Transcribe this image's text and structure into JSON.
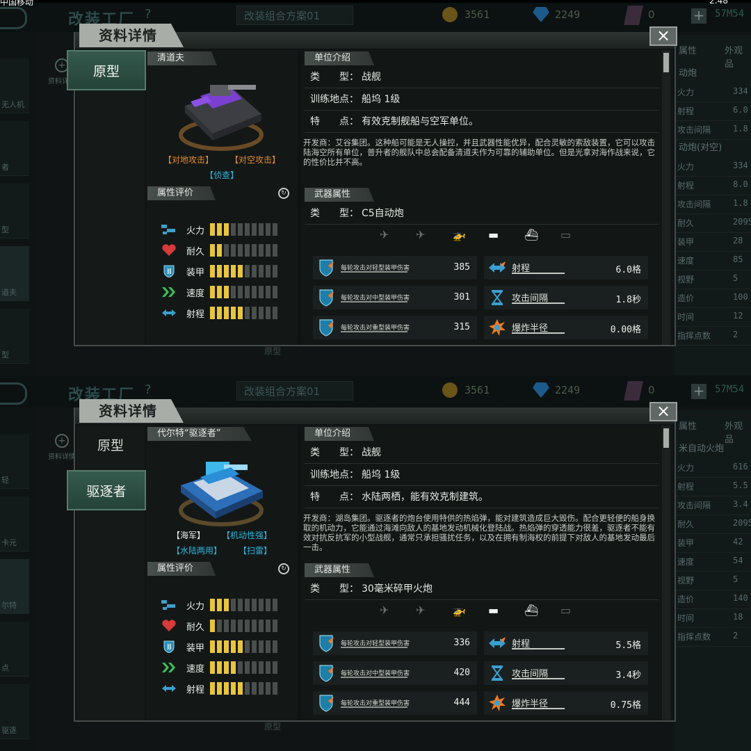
{
  "status_bar": {
    "carrier": "中国移动",
    "time": "2:48"
  },
  "bg": {
    "title": "改装工厂",
    "help": "?",
    "plan": "改装组合方案01",
    "coins": "3561",
    "gems": "2249",
    "tokens": "0",
    "code": "57M54",
    "filter_top": "升者",
    "filter_bot": "型",
    "zoom_label": "资料详情",
    "bottom_label": "原型"
  },
  "top": {
    "dialog_title": "资料详情",
    "close_label": "×",
    "tabs": [
      "原型"
    ],
    "unit_name": "清道夫",
    "tags_line1": [
      "【对地攻击】",
      "【对空攻击】"
    ],
    "tags_line2": [
      "【侦查】"
    ],
    "attr_header": "属性评价",
    "attrs": [
      {
        "label": "火力",
        "value": 3
      },
      {
        "label": "耐久",
        "value": 2
      },
      {
        "label": "装甲",
        "value": 5
      },
      {
        "label": "速度",
        "value": 3
      },
      {
        "label": "射程",
        "value": 5
      }
    ],
    "intro_header": "单位介绍",
    "type_key": "类　　型：",
    "type_val": "战舰",
    "train_key": "训练地点：",
    "train_val": "船坞 1级",
    "feat_key": "特　　点：",
    "feat_val": "有效克制舰船与空军单位。",
    "desc": "开发商：艾谷集团。这种船可能是无人操控，并且武器性能优异，配合灵敏的索敌装置，它可以攻击陆海空所有单位，普升者的舰队中总会配备清道夫作为可靠的辅助单位。但是光拿对海作战来说，它的性价比并不高。",
    "weapon_header": "武器属性",
    "weapon_type_key": "类　　型：",
    "weapon_type_val": "C5自动炮",
    "targets_on": [
      false,
      false,
      true,
      true,
      true,
      false
    ],
    "dmg": [
      {
        "label": "每轮攻击对轻型装甲伤害",
        "value": "385"
      },
      {
        "label": "每轮攻击对中型装甲伤害",
        "value": "301"
      },
      {
        "label": "每轮攻击对重型装甲伤害",
        "value": "315"
      }
    ],
    "stats": [
      {
        "label": "射程",
        "value": "6.0格"
      },
      {
        "label": "攻击间隔",
        "value": "1.8秒"
      },
      {
        "label": "爆炸半径",
        "value": "0.00格"
      }
    ],
    "right_tabs": [
      "属性",
      "外观品"
    ],
    "right_rows": [
      {
        "h": "动炮"
      },
      {
        "k": "火力",
        "v": "334"
      },
      {
        "k": "射程",
        "v": "6.0"
      },
      {
        "k": "攻击间隔",
        "v": "1.8"
      },
      {
        "h": "动炮(对空)"
      },
      {
        "k": "火力",
        "v": "334"
      },
      {
        "k": "射程",
        "v": "8.0"
      },
      {
        "k": "攻击间隔",
        "v": "1.8"
      },
      {
        "k": "耐久",
        "v": "2095"
      },
      {
        "k": "装甲",
        "v": "28"
      },
      {
        "k": "速度",
        "v": "85"
      },
      {
        "k": "视野",
        "v": "5"
      },
      {
        "k": "造价",
        "v": "100"
      },
      {
        "k": "时间",
        "v": "12"
      },
      {
        "k": "指挥点数",
        "v": "2"
      }
    ],
    "left_thumbs": [
      "无人机",
      "者",
      "型",
      "道夫",
      "型"
    ]
  },
  "bot": {
    "dialog_title": "资料详情",
    "close_label": "×",
    "tabs": [
      "原型",
      "驱逐者"
    ],
    "unit_name": "代尔特“驱逐者”",
    "tags_line1": [
      "【海军】",
      "【机动性强】"
    ],
    "tags_line2": [
      "【水陆两用】",
      "【扫雷】"
    ],
    "attr_header": "属性评价",
    "attrs": [
      {
        "label": "火力",
        "value": 3
      },
      {
        "label": "耐久",
        "value": 1
      },
      {
        "label": "装甲",
        "value": 5
      },
      {
        "label": "速度",
        "value": 4
      },
      {
        "label": "射程",
        "value": 5
      }
    ],
    "intro_header": "单位介绍",
    "type_key": "类　　型：",
    "type_val": "战舰",
    "train_key": "训练地点：",
    "train_val": "船坞 1级",
    "feat_key": "特　　点：",
    "feat_val": "水陆两栖，能有效克制建筑。",
    "desc": "开发商：湖岛集团。驱逐者的炮台使用特供的热焰弹，能对建筑造成巨大毁伤。配合更轻便的船身换取的机动力，它能通过海滩向敌人的基地发动机械化登陆战。热焰弹的穿透能力很差，驱逐者不能有效对抗反抗军的小型战舰，通常只承担骚扰任务，以及在拥有制海权的前提下对敌人的基地发动最后一击。",
    "weapon_header": "武器属性",
    "weapon_type_key": "类　　型：",
    "weapon_type_val": "30毫米碎甲火炮",
    "targets_on": [
      false,
      false,
      true,
      true,
      true,
      false
    ],
    "dmg": [
      {
        "label": "每轮攻击对轻型装甲伤害",
        "value": "336"
      },
      {
        "label": "每轮攻击对中型装甲伤害",
        "value": "420"
      },
      {
        "label": "每轮攻击对重型装甲伤害",
        "value": "444"
      }
    ],
    "stats": [
      {
        "label": "射程",
        "value": "5.5格"
      },
      {
        "label": "攻击间隔",
        "value": "3.4秒"
      },
      {
        "label": "爆炸半径",
        "value": "0.75格"
      }
    ],
    "right_tabs": [
      "属性",
      "外观品"
    ],
    "right_rows": [
      {
        "h": "米自动火炮"
      },
      {
        "k": "火力",
        "v": "616"
      },
      {
        "k": "射程",
        "v": "5.5"
      },
      {
        "k": "攻击间隔",
        "v": "3.4"
      },
      {
        "k": "耐久",
        "v": "2095"
      },
      {
        "k": "装甲",
        "v": "42"
      },
      {
        "k": "速度",
        "v": "54"
      },
      {
        "k": "视野",
        "v": "5"
      },
      {
        "k": "造价",
        "v": "140"
      },
      {
        "k": "时间",
        "v": "18"
      },
      {
        "k": "指挥点数",
        "v": "2"
      }
    ],
    "left_thumbs": [
      "轻",
      "卡元",
      "尔特",
      "点",
      "驱逐"
    ]
  },
  "colors": {
    "bar_on": "#e8c53e",
    "bar_off": "#4a4f4d",
    "tag_orange": "#e48a2a",
    "tag_cyan": "#2fb3d8",
    "tag_white": "#e8ebe6",
    "panel_green": "#2f5447"
  },
  "icons": {
    "close": "close-icon",
    "refresh": "refresh-icon",
    "firepower": "firepower-icon",
    "durability": "heart-icon",
    "armor": "shield-icon",
    "speed": "chevron-double-icon",
    "range": "double-arrow-icon",
    "targets": [
      "plane-icon",
      "jet-icon",
      "helicopter-icon",
      "tank-icon",
      "ship-icon",
      "submarine-icon"
    ]
  }
}
